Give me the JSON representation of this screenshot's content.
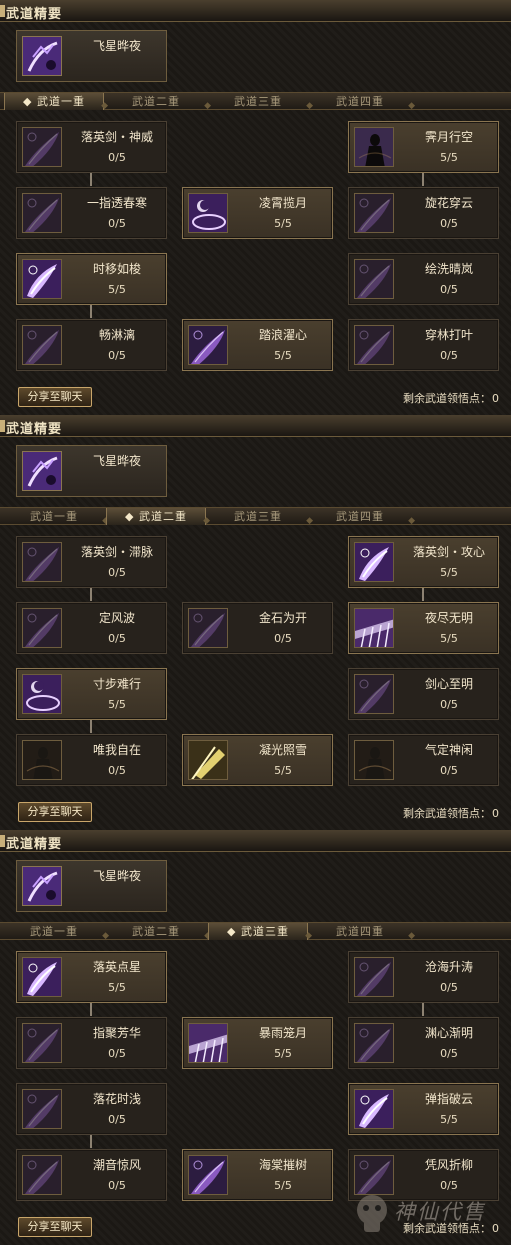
{
  "panels": [
    {
      "title": "武道精要",
      "core": {
        "name": "飞星晔夜"
      },
      "tabs": [
        "武道一重",
        "武道二重",
        "武道三重",
        "武道四重"
      ],
      "active_tab": 0,
      "skills": [
        {
          "name": "落英剑・神威",
          "level": "0/5",
          "learned": false,
          "icon": "sword-slash-icon"
        },
        {
          "name": "霁月行空",
          "level": "5/5",
          "learned": true,
          "icon": "shadow-figure-icon"
        },
        {
          "name": "一指透春寒",
          "level": "0/5",
          "learned": false,
          "icon": "sword-slash-icon"
        },
        {
          "name": "凌霄揽月",
          "level": "5/5",
          "learned": true,
          "icon": "moon-swirl-icon"
        },
        {
          "name": "旋花穿云",
          "level": "0/5",
          "learned": false,
          "icon": "sword-slash-icon"
        },
        {
          "name": "时移如梭",
          "level": "5/5",
          "learned": true,
          "icon": "light-slash-icon"
        },
        {
          "name": "绘洗晴岚",
          "level": "0/5",
          "learned": false,
          "icon": "sword-slash-icon"
        },
        {
          "name": "畅淋漓",
          "level": "0/5",
          "learned": false,
          "icon": "sword-slash-icon"
        },
        {
          "name": "踏浪濯心",
          "level": "5/5",
          "learned": true,
          "icon": "sword-slash-icon"
        },
        {
          "name": "穿林打叶",
          "level": "0/5",
          "learned": false,
          "icon": "sword-slash-icon"
        }
      ],
      "share_label": "分享至聊天",
      "remain_label": "剩余武道领悟点：",
      "remain_value": "0"
    },
    {
      "title": "武道精要",
      "core": {
        "name": "飞星晔夜"
      },
      "tabs": [
        "武道一重",
        "武道二重",
        "武道三重",
        "武道四重"
      ],
      "active_tab": 1,
      "skills": [
        {
          "name": "落英剑・滞脉",
          "level": "0/5",
          "learned": false,
          "icon": "sword-slash-icon"
        },
        {
          "name": "落英剑・攻心",
          "level": "5/5",
          "learned": true,
          "icon": "light-slash-icon"
        },
        {
          "name": "定风波",
          "level": "0/5",
          "learned": false,
          "icon": "sword-slash-icon"
        },
        {
          "name": "金石为开",
          "level": "0/5",
          "learned": false,
          "icon": "sword-slash-icon"
        },
        {
          "name": "夜尽无明",
          "level": "5/5",
          "learned": true,
          "icon": "light-burst-icon"
        },
        {
          "name": "寸步难行",
          "level": "5/5",
          "learned": true,
          "icon": "moon-swirl-icon"
        },
        {
          "name": "剑心至明",
          "level": "0/5",
          "learned": false,
          "icon": "sword-slash-icon"
        },
        {
          "name": "唯我自在",
          "level": "0/5",
          "learned": false,
          "icon": "dark-figure-icon"
        },
        {
          "name": "凝光照雪",
          "level": "5/5",
          "learned": true,
          "icon": "golden-light-icon"
        },
        {
          "name": "气定神闲",
          "level": "0/5",
          "learned": false,
          "icon": "dark-figure-icon"
        }
      ],
      "share_label": "分享至聊天",
      "remain_label": "剩余武道领悟点：",
      "remain_value": "0"
    },
    {
      "title": "武道精要",
      "core": {
        "name": "飞星晔夜"
      },
      "tabs": [
        "武道一重",
        "武道二重",
        "武道三重",
        "武道四重"
      ],
      "active_tab": 2,
      "skills": [
        {
          "name": "落英点星",
          "level": "5/5",
          "learned": true,
          "icon": "light-slash-icon"
        },
        {
          "name": "沧海升涛",
          "level": "0/5",
          "learned": false,
          "icon": "sword-slash-icon"
        },
        {
          "name": "指聚芳华",
          "level": "0/5",
          "learned": false,
          "icon": "sword-slash-icon"
        },
        {
          "name": "暴雨笼月",
          "level": "5/5",
          "learned": true,
          "icon": "light-burst-icon"
        },
        {
          "name": "渊心渐明",
          "level": "0/5",
          "learned": false,
          "icon": "sword-slash-icon"
        },
        {
          "name": "落花时浅",
          "level": "0/5",
          "learned": false,
          "icon": "sword-slash-icon"
        },
        {
          "name": "弹指破云",
          "level": "5/5",
          "learned": true,
          "icon": "light-slash-icon"
        },
        {
          "name": "潮音惊风",
          "level": "0/5",
          "learned": false,
          "icon": "sword-slash-icon"
        },
        {
          "name": "海棠摧树",
          "level": "5/5",
          "learned": true,
          "icon": "sword-slash-icon"
        },
        {
          "name": "凭风折柳",
          "level": "0/5",
          "learned": false,
          "icon": "sword-slash-icon"
        }
      ],
      "share_label": "分享至聊天",
      "remain_label": "剩余武道领悟点：",
      "remain_value": "0"
    }
  ],
  "watermark": "神仙代售"
}
